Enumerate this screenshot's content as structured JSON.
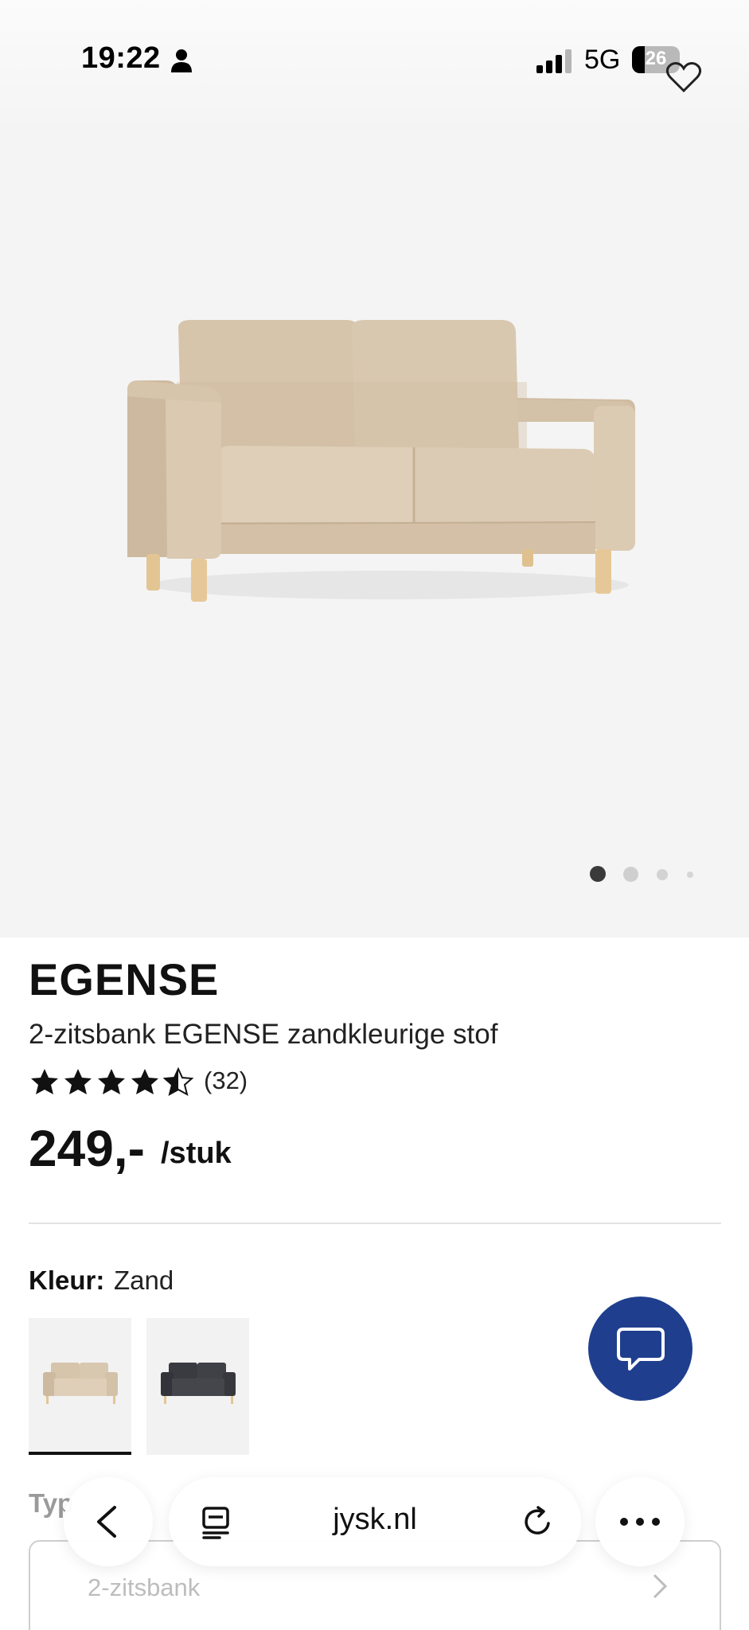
{
  "status_bar": {
    "time": "19:22",
    "network": "5G",
    "battery": "26"
  },
  "carousel": {
    "slides": 4,
    "active_index": 1
  },
  "product": {
    "name": "EGENSE",
    "description": "2-zitsbank EGENSE zandkleurige stof",
    "rating": 4.5,
    "rating_max": 5,
    "review_count": "(32)",
    "price": "249,-",
    "price_unit": "/stuk"
  },
  "color_selector": {
    "label": "Kleur:",
    "selected": "Zand",
    "swatches": [
      {
        "name": "Zand",
        "color": "#d8c7ae"
      },
      {
        "name": "Donkergrijs",
        "color": "#3a3b40"
      }
    ]
  },
  "type_selector": {
    "label": "Typ",
    "value": "2-zitsbank"
  },
  "browser": {
    "url": "jysk.nl"
  },
  "colors": {
    "chat_button": "#1f3f8e",
    "hero_background": "#f4f4f4",
    "sofa_fabric": "#d8c7ae",
    "sofa_legs": "#e2c495"
  }
}
